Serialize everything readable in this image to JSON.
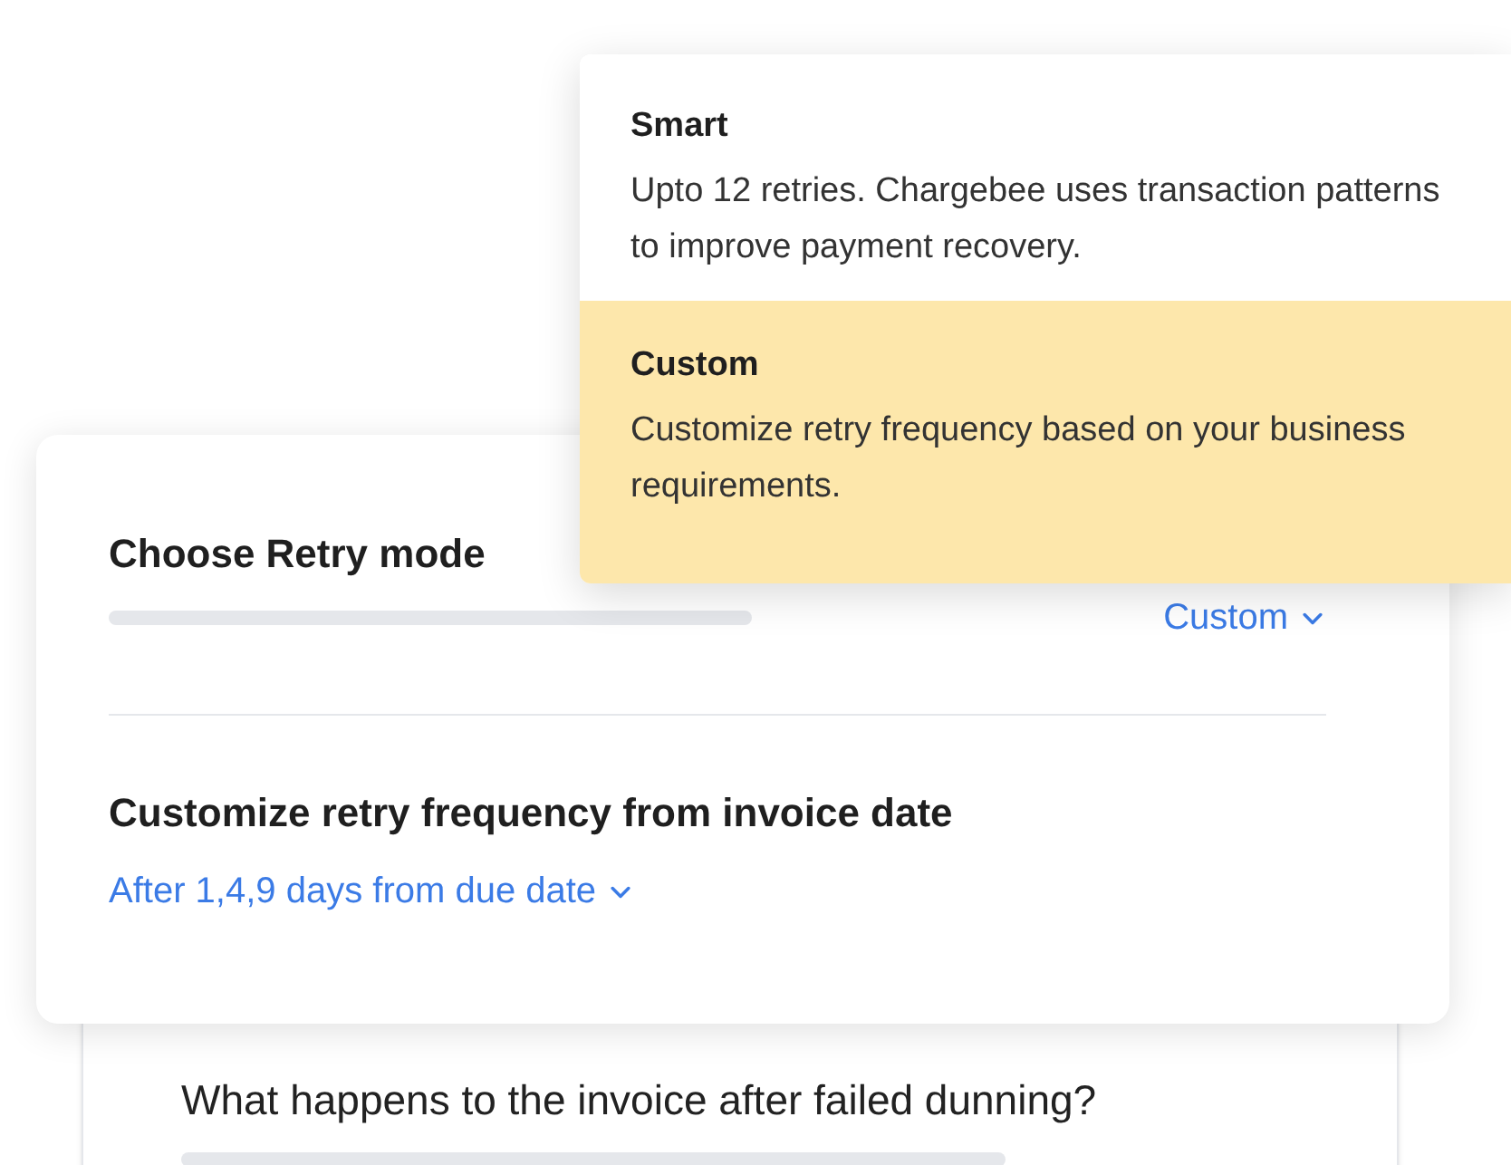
{
  "retry_mode_menu": {
    "options": [
      {
        "title": "Smart",
        "description": "Upto 12 retries. Chargebee uses transaction patterns to improve payment recovery.",
        "selected": false
      },
      {
        "title": "Custom",
        "description": "Customize retry frequency based on your business requirements.",
        "selected": true
      }
    ]
  },
  "retry_card": {
    "mode_label": "Choose Retry mode",
    "mode_value": "Custom",
    "frequency_label": "Customize retry frequency from invoice date",
    "frequency_value": "After 1,4,9 days from due date"
  },
  "background_card": {
    "question": "What happens to the invoice after failed dunning?"
  }
}
